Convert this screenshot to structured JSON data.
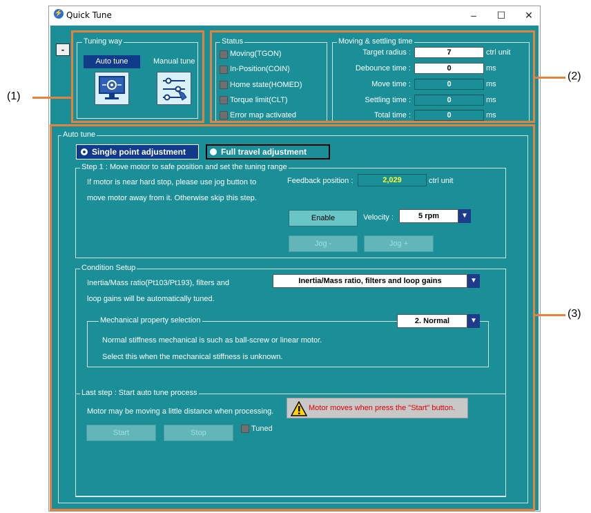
{
  "window": {
    "title": "Quick Tune",
    "minimize": "–",
    "maximize": "☐",
    "close": "✕"
  },
  "collapse_label": "-",
  "tuning_way": {
    "legend": "Tuning way",
    "auto_label": "Auto tune",
    "manual_label": "Manual tune"
  },
  "status": {
    "legend": "Status",
    "items": [
      "Moving(TGON)",
      "In-Position(COIN)",
      "Home state(HOMED)",
      "Torque limit(CLT)",
      "Error map activated"
    ]
  },
  "settling": {
    "legend": "Moving & settling time",
    "rows": [
      {
        "label": "Target radius :",
        "value": "7",
        "unit": "ctrl unit"
      },
      {
        "label": "Debounce time :",
        "value": "0",
        "unit": "ms"
      },
      {
        "label": "Move time :",
        "value": "0",
        "unit": "ms"
      },
      {
        "label": "Settling time :",
        "value": "0",
        "unit": "ms"
      },
      {
        "label": "Total time :",
        "value": "0",
        "unit": "ms"
      }
    ]
  },
  "auto_tune": {
    "legend": "Auto tune",
    "mode_single": "Single point adjustment",
    "mode_full": "Full travel adjustment",
    "step1": {
      "legend": "Step 1 : Move motor to safe position and set the tuning range",
      "line1": "If motor is near hard stop, please use jog button to",
      "line2": "move motor away from it. Otherwise skip this step.",
      "feedback_label": "Feedback position :",
      "feedback_value": "2,029",
      "feedback_unit": "ctrl unit",
      "enable": "Enable",
      "velocity_label": "Velocity :",
      "velocity_value": "5 rpm",
      "jog_minus": "Jog -",
      "jog_plus": "Jog +"
    },
    "condition": {
      "legend": "Condition Setup",
      "line1": "Inertia/Mass ratio(Pt103/Pt193), filters and",
      "line2": "loop gains will be automatically tuned.",
      "select_value": "Inertia/Mass ratio, filters and loop gains",
      "mech": {
        "legend": "Mechanical property selection",
        "line1": "Normal stiffness mechanical is such as ball-screw or linear motor.",
        "line2": "Select this when the mechanical stiffness is unknown.",
        "select_value": "2. Normal"
      }
    },
    "last_step": {
      "legend": "Last step : Start auto tune process",
      "note": "Motor may be moving a little distance when processing.",
      "warning": "Motor moves when press the \"Start\" button.",
      "start": "Start",
      "stop": "Stop",
      "tuned": "Tuned"
    }
  },
  "callouts": [
    "(1)",
    "(2)",
    "(3)"
  ],
  "colors": {
    "panel": "#1b8f97",
    "callout": "#e7813b",
    "selected_mode": "#123a8a",
    "warning_text": "#e00000"
  }
}
